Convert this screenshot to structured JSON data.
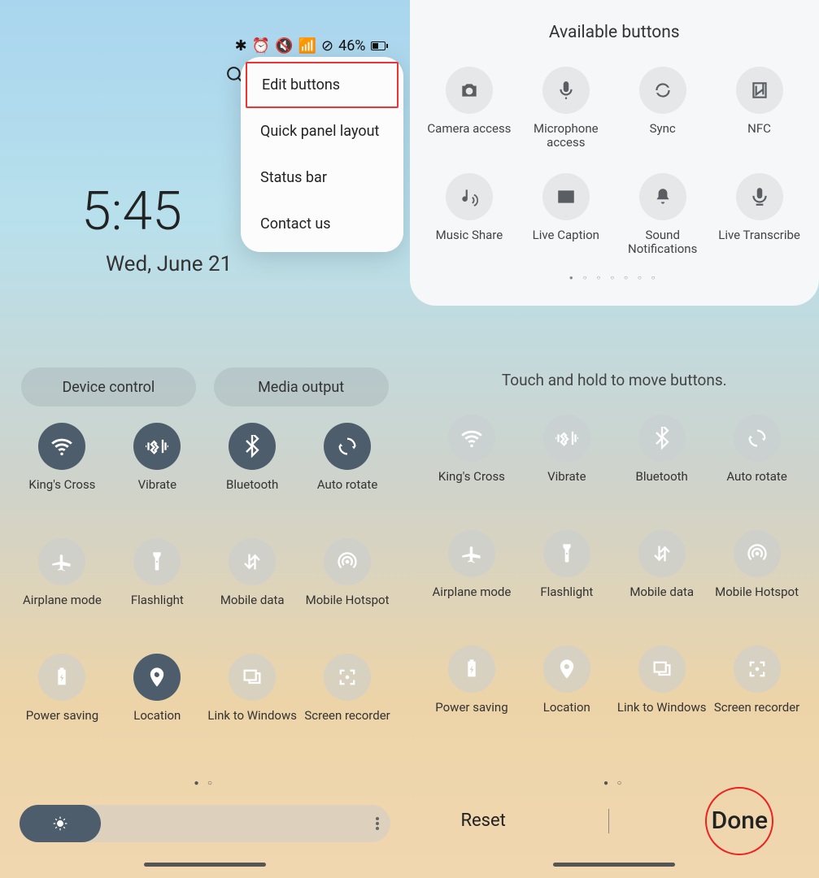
{
  "left": {
    "status": {
      "battery_pct": "46%"
    },
    "time": "5:45",
    "date": "Wed, June 21",
    "chips": {
      "device_control": "Device control",
      "media_output": "Media output"
    },
    "popup": {
      "edit_buttons": "Edit buttons",
      "quick_panel_layout": "Quick panel layout",
      "status_bar": "Status bar",
      "contact_us": "Contact us"
    },
    "tiles": [
      {
        "id": "wifi",
        "label": "King's Cross",
        "active": true
      },
      {
        "id": "vibrate",
        "label": "Vibrate",
        "active": true
      },
      {
        "id": "bluetooth",
        "label": "Bluetooth",
        "active": true
      },
      {
        "id": "autorotate",
        "label": "Auto rotate",
        "active": true
      },
      {
        "id": "airplane",
        "label": "Airplane mode",
        "active": false
      },
      {
        "id": "flashlight",
        "label": "Flashlight",
        "active": false
      },
      {
        "id": "mobiledata",
        "label": "Mobile data",
        "active": false
      },
      {
        "id": "hotspot",
        "label": "Mobile Hotspot",
        "active": false
      },
      {
        "id": "powersaving",
        "label": "Power saving",
        "active": false
      },
      {
        "id": "location",
        "label": "Location",
        "active": true
      },
      {
        "id": "link2win",
        "label": "Link to Windows",
        "active": false
      },
      {
        "id": "screenrec",
        "label": "Screen recorder",
        "active": false
      }
    ]
  },
  "right": {
    "available_title": "Available buttons",
    "available": [
      {
        "id": "camaccess",
        "label": "Camera access"
      },
      {
        "id": "micaccess",
        "label": "Microphone access"
      },
      {
        "id": "sync",
        "label": "Sync"
      },
      {
        "id": "nfc",
        "label": "NFC"
      },
      {
        "id": "musicshare",
        "label": "Music Share"
      },
      {
        "id": "livecaption",
        "label": "Live Caption"
      },
      {
        "id": "soundnotif",
        "label": "Sound Notifications"
      },
      {
        "id": "livetranscribe",
        "label": "Live Transcribe"
      }
    ],
    "hint": "Touch and hold to move buttons.",
    "tiles": [
      {
        "id": "wifi",
        "label": "King's Cross"
      },
      {
        "id": "vibrate",
        "label": "Vibrate"
      },
      {
        "id": "bluetooth",
        "label": "Bluetooth"
      },
      {
        "id": "autorotate",
        "label": "Auto rotate"
      },
      {
        "id": "airplane",
        "label": "Airplane mode"
      },
      {
        "id": "flashlight",
        "label": "Flashlight"
      },
      {
        "id": "mobiledata",
        "label": "Mobile data"
      },
      {
        "id": "hotspot",
        "label": "Mobile Hotspot"
      },
      {
        "id": "powersaving",
        "label": "Power saving"
      },
      {
        "id": "location",
        "label": "Location"
      },
      {
        "id": "link2win",
        "label": "Link to Windows"
      },
      {
        "id": "screenrec",
        "label": "Screen recorder"
      }
    ],
    "reset": "Reset",
    "done": "Done"
  }
}
